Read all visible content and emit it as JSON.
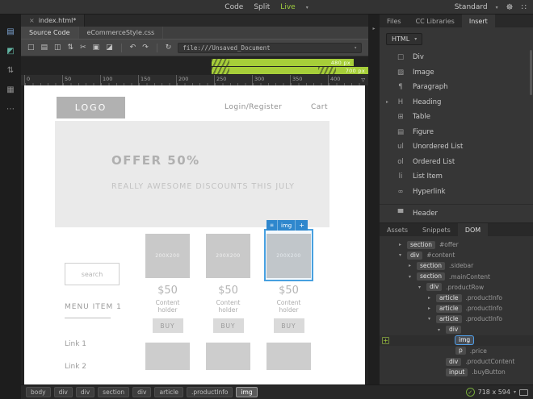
{
  "colors": {
    "accent_green": "#a6ce39",
    "selection_blue": "#47a0e0",
    "ui_dark": "#2b2b2b"
  },
  "icons": {
    "close": "×",
    "chevron_down": "▾",
    "gear": "☸",
    "workspace_grid": "∷",
    "new_doc": "□",
    "open": "▤",
    "save": "◫",
    "transfer": "⇅",
    "cut": "✂",
    "copy": "▣",
    "extra": "◪",
    "undo": "↶",
    "redo": "↷",
    "refresh": "↻",
    "ruler_marker": "▽",
    "more": "⋯",
    "check": "✓",
    "plus": "+",
    "menu": "≡",
    "arrow_collapsed": "▸",
    "arrow_expanded": "▾",
    "panel_collapse": "▸",
    "rail_files": "▤",
    "rail_extract": "◩",
    "rail_transfer": "⇅",
    "rail_css": "▦"
  },
  "topbar": {
    "modes": [
      {
        "label": "Code"
      },
      {
        "label": "Split"
      },
      {
        "label": "Live"
      }
    ],
    "active_mode": "Live",
    "workspace_label": "Standard"
  },
  "tabbar": {
    "tab": "index.html*"
  },
  "related_files": {
    "items": [
      "Source Code",
      "eCommerceStyle.css"
    ]
  },
  "toolbar": {
    "url": "file:///Unsaved_Document"
  },
  "media_bars": [
    {
      "label": "480 px"
    },
    {
      "label": "700 px"
    }
  ],
  "ruler": {
    "labels": [
      "0",
      "50",
      "100",
      "150",
      "200",
      "250",
      "300",
      "350",
      "400"
    ]
  },
  "page": {
    "logo": "LOGO",
    "nav": {
      "login": "Login/Register",
      "cart": "Cart"
    },
    "hero": {
      "title": "OFFER 50%",
      "subtitle": "REALLY AWESOME DISCOUNTS THIS JULY"
    },
    "sidebar": {
      "search_placeholder": "search",
      "menu_title": "MENU ITEM 1",
      "links": [
        "Link 1",
        "Link 2"
      ]
    },
    "products": [
      {
        "image_label": "200X200",
        "price": "$50",
        "desc": "Content holder",
        "buy": "BUY"
      },
      {
        "image_label": "200X200",
        "price": "$50",
        "desc": "Content holder",
        "buy": "BUY"
      },
      {
        "image_label": "200X200",
        "price": "$50",
        "desc": "Content holder",
        "buy": "BUY"
      }
    ],
    "selection_tag": {
      "label": "img"
    }
  },
  "right_panel": {
    "tabs": [
      "Files",
      "CC Libraries",
      "Insert"
    ],
    "active_tab": "Insert",
    "category": "HTML",
    "items": [
      {
        "glyph": "□",
        "label": "Div"
      },
      {
        "glyph": "▨",
        "label": "Image"
      },
      {
        "glyph": "¶",
        "label": "Paragraph"
      },
      {
        "glyph": "H",
        "label": "Heading"
      },
      {
        "glyph": "⊞",
        "label": "Table"
      },
      {
        "glyph": "▤",
        "label": "Figure"
      },
      {
        "glyph": "ul",
        "label": "Unordered List"
      },
      {
        "glyph": "ol",
        "label": "Ordered List"
      },
      {
        "glyph": "li",
        "label": "List Item"
      },
      {
        "glyph": "∞",
        "label": "Hyperlink"
      },
      {
        "glyph": "▀",
        "label": "Header"
      }
    ]
  },
  "dom_panel": {
    "tabs": [
      "Assets",
      "Snippets",
      "DOM"
    ],
    "active_tab": "DOM",
    "tree": [
      {
        "tag": "section",
        "qualifier": "#offer",
        "level": 1,
        "state": "collapsed"
      },
      {
        "tag": "div",
        "qualifier": "#content",
        "level": 1,
        "state": "expanded"
      },
      {
        "tag": "section",
        "qualifier": ".sidebar",
        "level": 2,
        "state": "collapsed"
      },
      {
        "tag": "section",
        "qualifier": ".mainContent",
        "level": 2,
        "state": "expanded"
      },
      {
        "tag": "div",
        "qualifier": ".productRow",
        "level": 3,
        "state": "expanded"
      },
      {
        "tag": "article",
        "qualifier": ".productInfo",
        "level": 4,
        "state": "collapsed"
      },
      {
        "tag": "article",
        "qualifier": ".productInfo",
        "level": 4,
        "state": "collapsed"
      },
      {
        "tag": "article",
        "qualifier": ".productInfo",
        "level": 4,
        "state": "expanded"
      },
      {
        "tag": "div",
        "qualifier": "",
        "level": 5,
        "state": "expanded"
      },
      {
        "tag": "img",
        "qualifier": "",
        "level": 6,
        "state": "leaf",
        "selected": true
      },
      {
        "tag": "p",
        "qualifier": ".price",
        "level": 6,
        "state": "leaf"
      },
      {
        "tag": "div",
        "qualifier": ".productContent",
        "level": 5,
        "state": "leaf"
      },
      {
        "tag": "input",
        "qualifier": ".buyButton",
        "level": 5,
        "state": "leaf"
      }
    ]
  },
  "statusbar": {
    "tags": [
      "body",
      "div",
      "div",
      "section",
      "div",
      "article",
      ".productInfo",
      "img"
    ],
    "selected_tag": "img",
    "viewport": "718 x 594"
  }
}
